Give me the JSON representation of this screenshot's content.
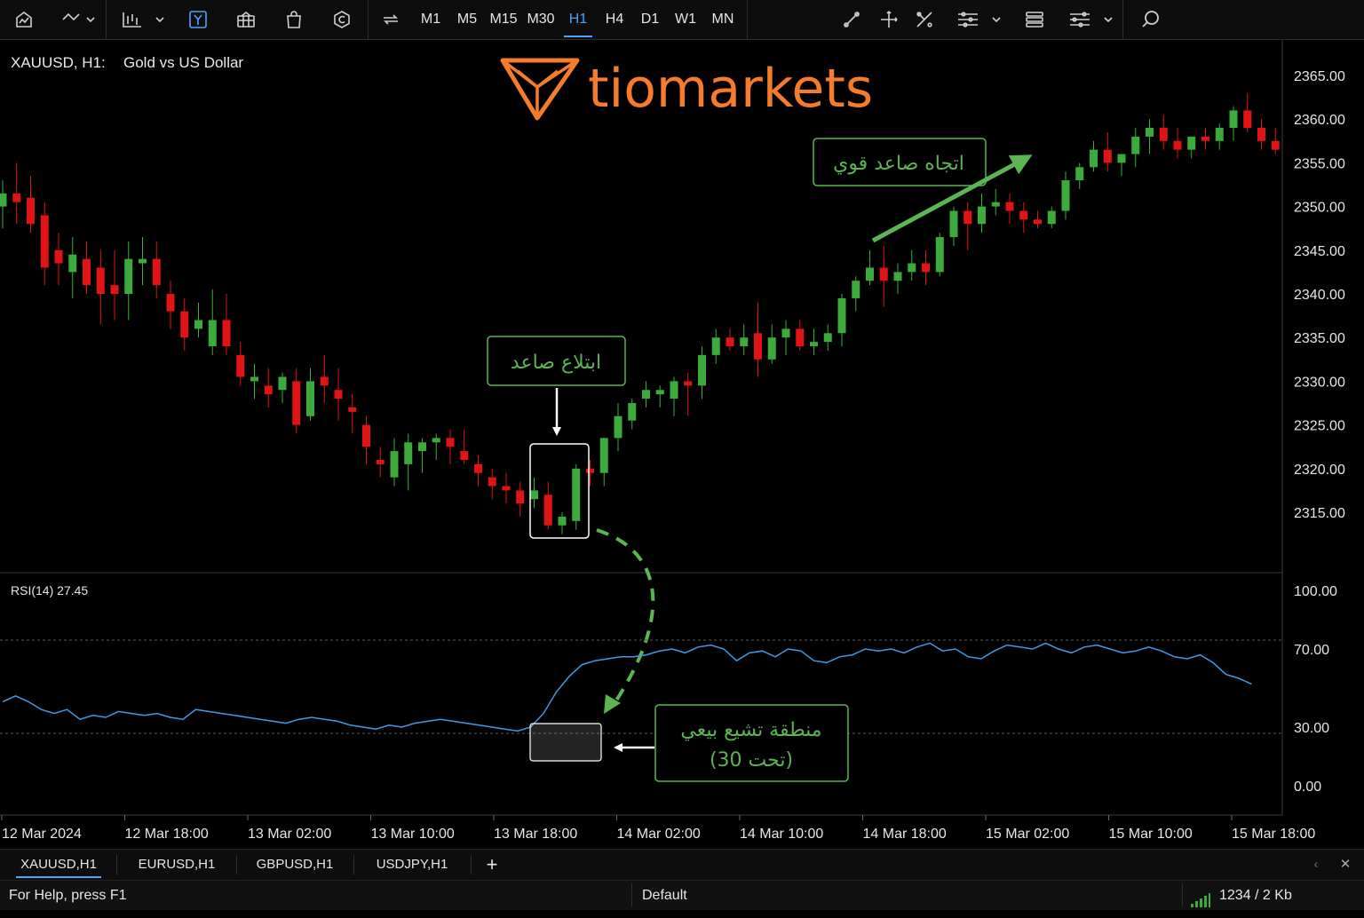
{
  "toolbar": {
    "left_icons": [
      "home-chart-icon",
      "undo-redo-icon",
      "indicators-icon",
      "expert-icon",
      "templates-icon",
      "shopping-bag-icon",
      "copyright-icon",
      "replay-icon"
    ],
    "timeframes": [
      "M1",
      "M5",
      "M15",
      "M30",
      "H1",
      "H4",
      "D1",
      "W1",
      "MN"
    ],
    "active_timeframe": "H1",
    "right_icons": [
      "trendline-icon",
      "crosshair-icon",
      "drawing-tools-icon",
      "objects-list-icon",
      "layers-icon",
      "settings-sliders-icon",
      "search-icon"
    ]
  },
  "chart": {
    "symbol_title": "XAUUSD, H1:",
    "symbol_name": "Gold vs US Dollar",
    "brand": "tiomarkets",
    "brand_color": "#f57c2b",
    "up_color": "#3cab3c",
    "down_color": "#e01414",
    "price_axis": [
      "2365.00",
      "2360.00",
      "2355.00",
      "2350.00",
      "2345.00",
      "2340.00",
      "2335.00",
      "2330.00",
      "2325.00",
      "2320.00",
      "2315.00"
    ],
    "time_axis": [
      "12 Mar 2024",
      "12 Mar 18:00",
      "13 Mar 02:00",
      "13 Mar 10:00",
      "13 Mar 18:00",
      "14 Mar 02:00",
      "14 Mar 10:00",
      "14 Mar 18:00",
      "15 Mar 02:00",
      "15 Mar 10:00",
      "15 Mar 18:00"
    ],
    "annotations": {
      "engulfing": "ابتلاع صاعد",
      "uptrend": "اتجاه صاعد قوي",
      "oversold_line1": "منطقة تشيع بيعي",
      "oversold_line2": "(تحت 30)"
    },
    "annotation_color": "#5ab552"
  },
  "rsi": {
    "label": "RSI(14) 27.45",
    "axis": [
      "100.00",
      "70.00",
      "30.00",
      "0.00"
    ],
    "line_color": "#3d9be9"
  },
  "chart_data": [
    {
      "type": "candlestick",
      "title": "XAUUSD, H1: Gold vs US Dollar",
      "y_range": [
        2310,
        2368
      ],
      "candles_ohlc": [
        [
          2350.0,
          2353.0,
          2347.5,
          2351.5
        ],
        [
          2351.5,
          2355.0,
          2348.0,
          2350.5
        ],
        [
          2351.0,
          2353.5,
          2347.0,
          2348.0
        ],
        [
          2349.0,
          2350.5,
          2341.0,
          2343.0
        ],
        [
          2345.0,
          2347.0,
          2341.0,
          2343.5
        ],
        [
          2342.5,
          2346.5,
          2339.5,
          2344.5
        ],
        [
          2344.0,
          2346.0,
          2340.0,
          2341.0
        ],
        [
          2343.0,
          2345.0,
          2336.5,
          2340.0
        ],
        [
          2341.0,
          2345.0,
          2337.0,
          2340.0
        ],
        [
          2340.0,
          2346.0,
          2337.0,
          2344.0
        ],
        [
          2343.5,
          2346.5,
          2341.0,
          2344.0
        ],
        [
          2344.0,
          2346.0,
          2339.5,
          2341.0
        ],
        [
          2340.0,
          2341.5,
          2336.0,
          2338.0
        ],
        [
          2338.0,
          2339.5,
          2333.5,
          2335.0
        ],
        [
          2336.0,
          2339.0,
          2335.0,
          2337.0
        ],
        [
          2334.0,
          2340.5,
          2333.0,
          2337.0
        ],
        [
          2337.0,
          2340.0,
          2333.0,
          2334.0
        ],
        [
          2333.0,
          2334.5,
          2329.5,
          2330.5
        ],
        [
          2330.0,
          2332.0,
          2328.0,
          2330.5
        ],
        [
          2329.5,
          2331.5,
          2327.0,
          2328.5
        ],
        [
          2329.0,
          2331.0,
          2327.5,
          2330.5
        ],
        [
          2330.0,
          2331.5,
          2324.0,
          2325.0
        ],
        [
          2326.0,
          2331.5,
          2325.5,
          2330.0
        ],
        [
          2330.5,
          2333.0,
          2327.5,
          2329.5
        ],
        [
          2329.0,
          2331.5,
          2325.5,
          2328.0
        ],
        [
          2327.0,
          2328.5,
          2324.0,
          2326.5
        ],
        [
          2325.0,
          2326.0,
          2320.5,
          2322.5
        ],
        [
          2321.0,
          2322.5,
          2319.0,
          2320.5
        ],
        [
          2319.0,
          2323.5,
          2318.0,
          2322.0
        ],
        [
          2320.5,
          2324.0,
          2317.5,
          2323.0
        ],
        [
          2322.0,
          2323.5,
          2319.5,
          2323.0
        ],
        [
          2323.0,
          2324.0,
          2321.0,
          2323.5
        ],
        [
          2323.5,
          2324.5,
          2320.5,
          2322.5
        ],
        [
          2322.0,
          2324.5,
          2320.5,
          2321.0
        ],
        [
          2320.5,
          2321.5,
          2318.0,
          2319.5
        ],
        [
          2319.0,
          2320.0,
          2316.5,
          2318.0
        ],
        [
          2318.0,
          2319.5,
          2316.0,
          2317.5
        ],
        [
          2317.5,
          2318.5,
          2314.5,
          2316.0
        ],
        [
          2316.5,
          2319.0,
          2315.5,
          2317.5
        ],
        [
          2317.0,
          2318.5,
          2313.0,
          2313.5
        ],
        [
          2313.5,
          2315.0,
          2312.5,
          2314.5
        ],
        [
          2314.0,
          2320.5,
          2313.0,
          2320.0
        ],
        [
          2320.0,
          2321.0,
          2318.0,
          2319.5
        ],
        [
          2319.5,
          2323.5,
          2318.0,
          2323.5
        ],
        [
          2323.5,
          2327.5,
          2322.0,
          2326.0
        ],
        [
          2325.5,
          2328.0,
          2324.5,
          2327.5
        ],
        [
          2328.0,
          2330.0,
          2327.0,
          2329.0
        ],
        [
          2328.5,
          2329.5,
          2327.0,
          2329.0
        ],
        [
          2328.0,
          2330.5,
          2326.0,
          2330.0
        ],
        [
          2330.0,
          2331.0,
          2326.0,
          2329.5
        ],
        [
          2329.5,
          2334.0,
          2328.0,
          2333.0
        ],
        [
          2333.0,
          2336.0,
          2332.0,
          2335.0
        ],
        [
          2335.0,
          2336.0,
          2333.5,
          2334.0
        ],
        [
          2334.0,
          2336.5,
          2333.0,
          2335.0
        ],
        [
          2335.5,
          2339.0,
          2330.5,
          2332.5
        ],
        [
          2332.5,
          2336.5,
          2332.0,
          2335.0
        ],
        [
          2335.0,
          2337.0,
          2333.0,
          2336.0
        ],
        [
          2336.0,
          2337.0,
          2333.5,
          2334.0
        ],
        [
          2334.0,
          2336.0,
          2333.0,
          2334.5
        ],
        [
          2334.5,
          2336.5,
          2333.5,
          2335.5
        ],
        [
          2335.5,
          2340.0,
          2334.0,
          2339.5
        ],
        [
          2339.5,
          2342.0,
          2338.0,
          2341.5
        ],
        [
          2341.5,
          2345.0,
          2341.0,
          2343.0
        ],
        [
          2343.0,
          2345.5,
          2338.5,
          2341.5
        ],
        [
          2341.5,
          2343.5,
          2340.0,
          2342.5
        ],
        [
          2342.5,
          2345.0,
          2341.5,
          2343.5
        ],
        [
          2343.5,
          2345.0,
          2341.0,
          2342.5
        ],
        [
          2342.5,
          2347.0,
          2342.0,
          2346.5
        ],
        [
          2346.5,
          2350.0,
          2345.5,
          2349.5
        ],
        [
          2349.5,
          2350.5,
          2345.0,
          2348.0
        ],
        [
          2348.0,
          2351.5,
          2347.0,
          2350.0
        ],
        [
          2350.0,
          2352.0,
          2349.0,
          2350.5
        ],
        [
          2350.5,
          2351.5,
          2348.0,
          2349.5
        ],
        [
          2349.5,
          2350.5,
          2347.0,
          2348.5
        ],
        [
          2348.5,
          2349.5,
          2347.5,
          2348.0
        ],
        [
          2348.0,
          2350.0,
          2347.5,
          2349.5
        ],
        [
          2349.5,
          2354.0,
          2348.5,
          2353.0
        ],
        [
          2353.0,
          2355.0,
          2352.0,
          2354.5
        ],
        [
          2354.5,
          2357.5,
          2354.0,
          2356.5
        ],
        [
          2356.5,
          2358.5,
          2354.0,
          2355.0
        ],
        [
          2355.0,
          2356.0,
          2353.5,
          2356.0
        ],
        [
          2356.0,
          2359.0,
          2354.5,
          2358.0
        ],
        [
          2358.0,
          2360.0,
          2356.0,
          2359.0
        ],
        [
          2359.0,
          2360.5,
          2356.5,
          2357.5
        ],
        [
          2357.5,
          2359.0,
          2355.5,
          2356.5
        ],
        [
          2356.5,
          2358.0,
          2355.5,
          2358.0
        ],
        [
          2358.0,
          2359.0,
          2356.5,
          2357.5
        ],
        [
          2357.5,
          2359.5,
          2356.5,
          2359.0
        ],
        [
          2359.0,
          2361.5,
          2357.5,
          2361.0
        ],
        [
          2361.0,
          2363.0,
          2358.5,
          2359.0
        ],
        [
          2359.0,
          2360.0,
          2356.5,
          2357.5
        ],
        [
          2357.5,
          2359.0,
          2356.0,
          2356.5
        ]
      ]
    },
    {
      "type": "line",
      "title": "RSI(14) 27.45",
      "y_range": [
        0,
        100
      ],
      "reference_lines": [
        70,
        30
      ],
      "values": [
        43,
        46,
        43,
        39,
        37,
        39,
        34,
        36,
        35,
        38,
        37,
        36,
        37,
        35,
        34,
        39,
        38,
        37,
        36,
        35,
        34,
        33,
        32,
        34,
        35,
        34,
        33,
        31,
        30,
        29,
        31,
        30,
        32,
        33,
        34,
        33,
        32,
        31,
        30,
        29,
        28,
        30,
        37,
        48,
        56,
        62,
        64,
        65,
        66,
        66,
        67,
        69,
        70,
        68,
        71,
        72,
        70,
        64,
        68,
        69,
        66,
        70,
        69,
        64,
        63,
        66,
        67,
        70,
        69,
        70,
        68,
        71,
        73,
        69,
        70,
        66,
        65,
        69,
        72,
        71,
        70,
        73,
        70,
        68,
        71,
        72,
        70,
        68,
        69,
        71,
        69,
        66,
        65,
        67,
        63,
        57,
        55,
        52
      ]
    }
  ]
}
